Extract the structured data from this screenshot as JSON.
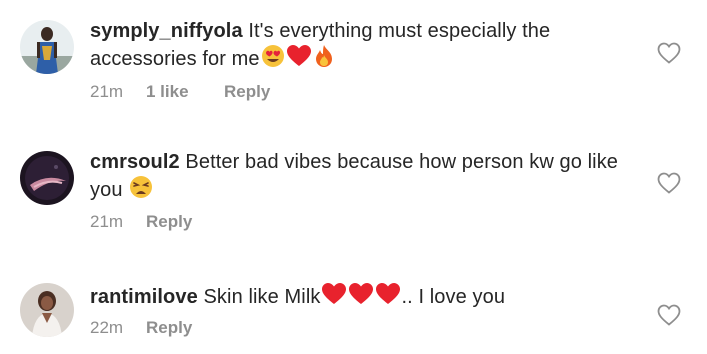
{
  "comments": [
    {
      "username": "symply_niffyola",
      "text": "It's everything must especially the accessories for me",
      "emojis": [
        "heart-eyes-emoji",
        "red-heart-emoji",
        "fire-emoji"
      ],
      "time": "21m",
      "likes": "1 like",
      "reply": "Reply",
      "avatar_color": "#5a7a6a"
    },
    {
      "username": "cmrsoul2",
      "text": "Better bad vibes because how person kw go like you",
      "emojis": [
        "weary-face-emoji"
      ],
      "time": "21m",
      "likes": "",
      "reply": "Reply",
      "avatar_color": "#2a1a2e"
    },
    {
      "username": "rantimilove",
      "text_before": "Skin  like  Milk",
      "text_after": ".. I love you",
      "emojis": [
        "red-heart-emoji",
        "red-heart-emoji",
        "red-heart-emoji"
      ],
      "time": "22m",
      "likes": "",
      "reply": "Reply",
      "avatar_color": "#c9bfb8"
    }
  ],
  "colors": {
    "text": "#262626",
    "meta": "#8e8e8e",
    "heart_outline": "#8e8e8e"
  },
  "icons": {
    "like": "heart-outline-icon"
  }
}
